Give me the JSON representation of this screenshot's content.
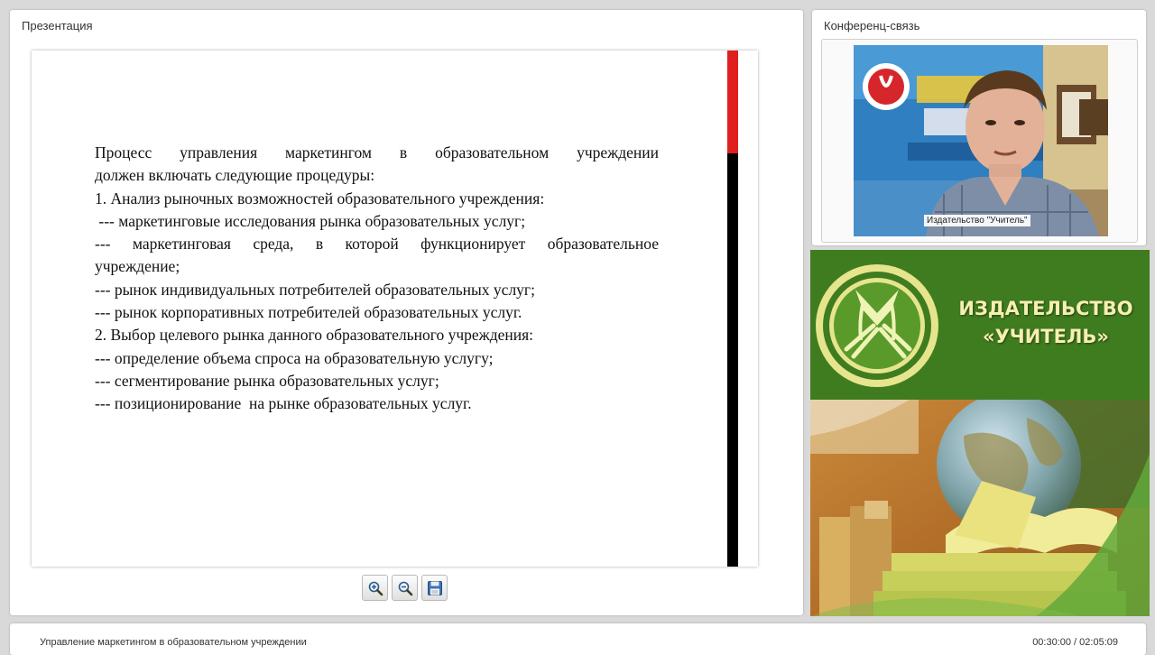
{
  "presentation": {
    "title": "Презентация",
    "slide": {
      "lines": [
        "Процесс управления маркетингом в образовательном учреждении",
        "должен включать следующие процедуры:",
        "1. Анализ рыночных возможностей образовательного учреждения:",
        " --- маркетинговые исследования рынка образовательных услуг;",
        "--- маркетинговая среда, в которой функционирует образовательное",
        "учреждение;",
        "--- рынок индивидуальных потребителей образовательных услуг;",
        "--- рынок корпоративных потребителей образовательных услуг.",
        "2. Выбор целевого рынка данного образовательного учреждения:",
        "--- определение объема спроса на образовательную услугу;",
        "--- сегментирование рынка образовательных услуг;",
        "--- позиционирование  на рынке образовательных услуг."
      ]
    },
    "toolbar": {
      "zoom_in_icon": "zoom-in-icon",
      "zoom_out_icon": "zoom-out-icon",
      "save_icon": "floppy-disk-icon"
    }
  },
  "conference": {
    "title": "Конференц-связь",
    "video_caption": "Издательство \"Учитель\""
  },
  "ad": {
    "brand_line1": "ИЗДАТЕЛЬСТВО",
    "brand_line2": "«УЧИТЕЛЬ»"
  },
  "footer": {
    "lecture_title": "Управление маркетингом в образовательном учреждении",
    "time": "00:30:00 / 02:05:09"
  },
  "colors": {
    "slide_bar_red": "#e0201f",
    "slide_bar_black": "#000000",
    "ad_green": "#3f7c1f",
    "ad_text": "#f6efb0"
  }
}
